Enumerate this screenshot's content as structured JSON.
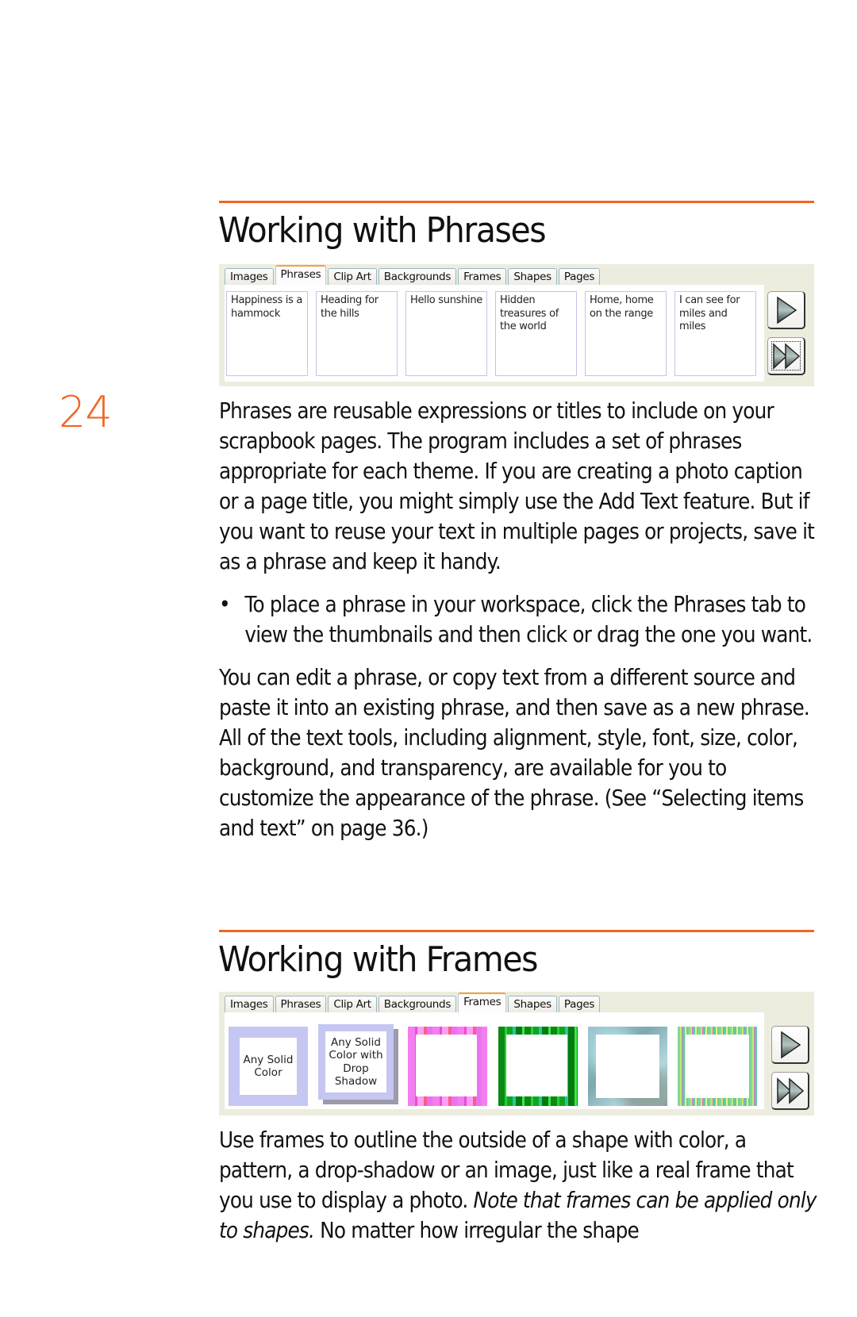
{
  "page_number": "24",
  "sections": {
    "phrases": {
      "heading": "Working with Phrases",
      "panel": {
        "tabs": [
          {
            "label": "Images",
            "active": false
          },
          {
            "label": "Phrases",
            "active": true
          },
          {
            "label": "Clip Art",
            "active": false
          },
          {
            "label": "Backgrounds",
            "active": false
          },
          {
            "label": "Frames",
            "active": false
          },
          {
            "label": "Shapes",
            "active": false
          },
          {
            "label": "Pages",
            "active": false
          }
        ],
        "items": [
          {
            "text": "Happiness is a hammock"
          },
          {
            "text": "Heading for the hills"
          },
          {
            "text": "Hello sunshine"
          },
          {
            "text": "Hidden treasures of the world"
          },
          {
            "text": "Home, home on the range"
          },
          {
            "text": "I can see for miles and miles"
          }
        ],
        "next_icon": "play-arrow-icon",
        "fast_forward_icon": "fast-forward-icon"
      },
      "paragraph1": "Phrases are reusable expressions or titles to include on your scrapbook pages. The program includes a set of phrases appropriate for each theme. If you are creating a photo caption or a page title, you might simply use the Add Text feature. But if you want to reuse your text in multiple pages or projects, save it as a phrase and keep it handy.",
      "bullet_symbol": "•",
      "bullet1": "To place a phrase in your workspace, click the Phrases tab to view the thumbnails and then click or drag the one you want.",
      "paragraph2": "You can edit a phrase, or copy text from a different source and paste it into an existing phrase, and then save as a new phrase. All of the text tools, including alignment, style, font, size, color, background, and transparency, are available for you to customize the appearance of the phrase. (See “Selecting items and text” on page 36.)"
    },
    "frames": {
      "heading": "Working with Frames",
      "panel": {
        "tabs": [
          {
            "label": "Images",
            "active": false
          },
          {
            "label": "Phrases",
            "active": false
          },
          {
            "label": "Clip Art",
            "active": false
          },
          {
            "label": "Backgrounds",
            "active": false
          },
          {
            "label": "Frames",
            "active": true
          },
          {
            "label": "Shapes",
            "active": false
          },
          {
            "label": "Pages",
            "active": false
          }
        ],
        "items": [
          {
            "label": "Any Solid Color",
            "style": "solid"
          },
          {
            "label": "Any Solid Color with Drop Shadow",
            "style": "shadow"
          },
          {
            "label": "",
            "style": "pink"
          },
          {
            "label": "",
            "style": "green"
          },
          {
            "label": "",
            "style": "gray"
          },
          {
            "label": "",
            "style": "stripe"
          }
        ],
        "next_icon": "play-arrow-icon",
        "fast_forward_icon": "fast-forward-icon"
      },
      "paragraph1_plain_a": "Use frames to outline the outside of a shape with color, a pattern, a drop-shadow or an image, just like a real frame that you use to display a photo. ",
      "paragraph1_italic": "Note that frames can be applied only to shapes.",
      "paragraph1_plain_b": " No matter how irregular the shape"
    }
  },
  "colors": {
    "accent_orange": "#f26522",
    "panel_bg": "#ecedde",
    "active_tab_border": "#f6a23c",
    "card_border": "#c7c3ea",
    "solid_frame": "#c6c6f2"
  }
}
